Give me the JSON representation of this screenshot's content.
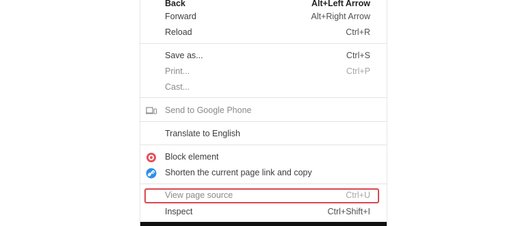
{
  "menu": {
    "back": {
      "label": "Back",
      "shortcut": "Alt+Left Arrow"
    },
    "forward": {
      "label": "Forward",
      "shortcut": "Alt+Right Arrow"
    },
    "reload": {
      "label": "Reload",
      "shortcut": "Ctrl+R"
    },
    "save_as": {
      "label": "Save as...",
      "shortcut": "Ctrl+S"
    },
    "print": {
      "label": "Print...",
      "shortcut": "Ctrl+P"
    },
    "cast": {
      "label": "Cast..."
    },
    "send_to_phone": {
      "label": "Send to Google Phone",
      "icon": "device-icon"
    },
    "translate": {
      "label": "Translate to English"
    },
    "block_element": {
      "label": "Block element",
      "icon": "block-element-icon",
      "icon_color": "#e8505b"
    },
    "shorten_link": {
      "label": "Shorten the current page link and copy",
      "icon": "link-icon",
      "icon_color": "#2f8fea"
    },
    "view_source": {
      "label": "View page source",
      "shortcut": "Ctrl+U",
      "highlight_color": "#d9484e"
    },
    "inspect": {
      "label": "Inspect",
      "shortcut": "Ctrl+Shift+I"
    }
  }
}
